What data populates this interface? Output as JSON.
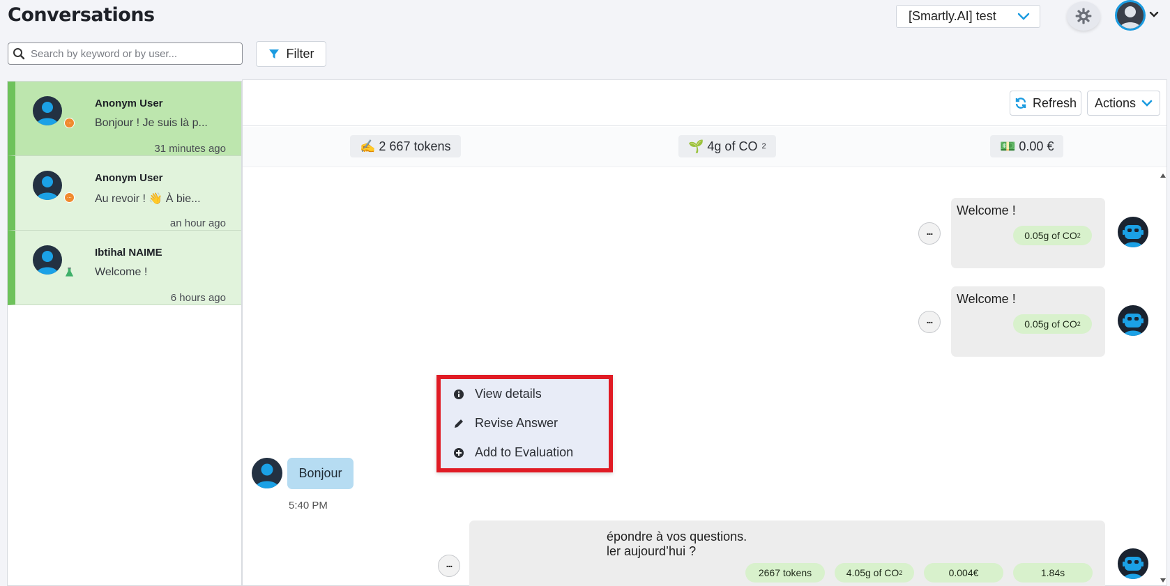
{
  "header": {
    "title": "Conversations",
    "bot_selector": "[Smartly.AI] test"
  },
  "search": {
    "placeholder": "Search by keyword or by user..."
  },
  "filter": {
    "label": "Filter"
  },
  "conversations": [
    {
      "name": "Anonym User",
      "preview": "Bonjour ! Je suis là p...",
      "time": "31 minutes ago",
      "active": true
    },
    {
      "name": "Anonym User",
      "preview": "Au revoir ! 👋 À bie...",
      "time": "an hour ago",
      "active": false
    },
    {
      "name": "Ibtihal NAIME",
      "preview": "Welcome !",
      "time": "6 hours ago",
      "active": false
    }
  ],
  "toolbar": {
    "refresh": "Refresh",
    "actions": "Actions"
  },
  "stats": {
    "tokens": "✍️ 2 667 tokens",
    "co2_prefix": "🌱 4g of CO",
    "co2_sub": "2",
    "cost": "💵 0.00 €"
  },
  "messages": {
    "bot1": {
      "text": "Welcome !",
      "co2_prefix": "0.05g of CO",
      "co2_sub": "2"
    },
    "bot2": {
      "text": "Welcome !",
      "co2_prefix": "0.05g of CO",
      "co2_sub": "2"
    },
    "user1": {
      "text": "Bonjour",
      "time": "5:40 PM"
    },
    "bot3": {
      "line1": "épondre à vos questions.",
      "line2": "ler aujourd’hui ?",
      "tokens": "2667 tokens",
      "co2_prefix": "4.05g of CO",
      "co2_sub": "2",
      "cost": "0.004€",
      "duration": "1.84s"
    }
  },
  "context_menu": {
    "view_details": "View details",
    "revise_answer": "Revise Answer",
    "add_to_evaluation": "Add to Evaluation"
  },
  "colors": {
    "accent_blue": "#1b9be0",
    "conversation_green": "#6ec25b",
    "highlight_red": "#e01b24"
  }
}
